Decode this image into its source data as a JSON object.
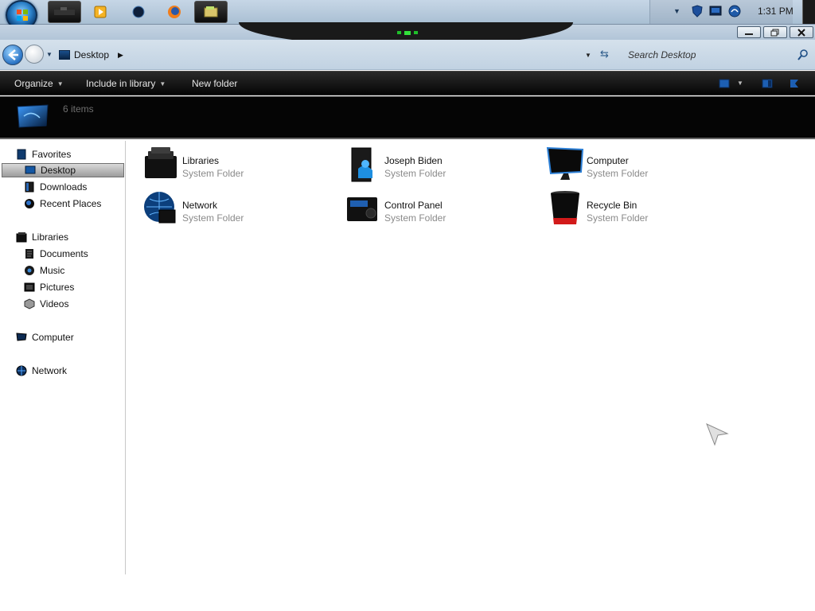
{
  "taskbar": {
    "clock": "1:31 PM",
    "buttons": [
      "media-player-icon",
      "blue-ball-icon",
      "firefox-icon",
      "explorer-icon"
    ]
  },
  "address": {
    "location": "Desktop",
    "search_placeholder": "Search Desktop"
  },
  "commandbar": {
    "organize": "Organize",
    "include": "Include in library",
    "new_folder": "New folder"
  },
  "details": {
    "count": "6 items"
  },
  "sidebar": {
    "favorites": {
      "label": "Favorites",
      "items": [
        {
          "label": "Desktop",
          "selected": true
        },
        {
          "label": "Downloads"
        },
        {
          "label": "Recent Places"
        }
      ]
    },
    "libraries": {
      "label": "Libraries",
      "items": [
        {
          "label": "Documents"
        },
        {
          "label": "Music"
        },
        {
          "label": "Pictures"
        },
        {
          "label": "Videos"
        }
      ]
    },
    "computer": {
      "label": "Computer"
    },
    "network": {
      "label": "Network"
    }
  },
  "items": [
    {
      "name": "Libraries",
      "type": "System Folder",
      "icon": "libraries-icon"
    },
    {
      "name": "Joseph Biden",
      "type": "System Folder",
      "icon": "user-folder-icon"
    },
    {
      "name": "Computer",
      "type": "System Folder",
      "icon": "computer-icon"
    },
    {
      "name": "Network",
      "type": "System Folder",
      "icon": "network-icon"
    },
    {
      "name": "Control Panel",
      "type": "System Folder",
      "icon": "control-panel-icon"
    },
    {
      "name": "Recycle Bin",
      "type": "System Folder",
      "icon": "recycle-bin-icon"
    }
  ],
  "colors": {
    "accent": "#1f7fd6",
    "toolbar_bg": "#050505",
    "selected_bg": "#b4b4b4"
  }
}
